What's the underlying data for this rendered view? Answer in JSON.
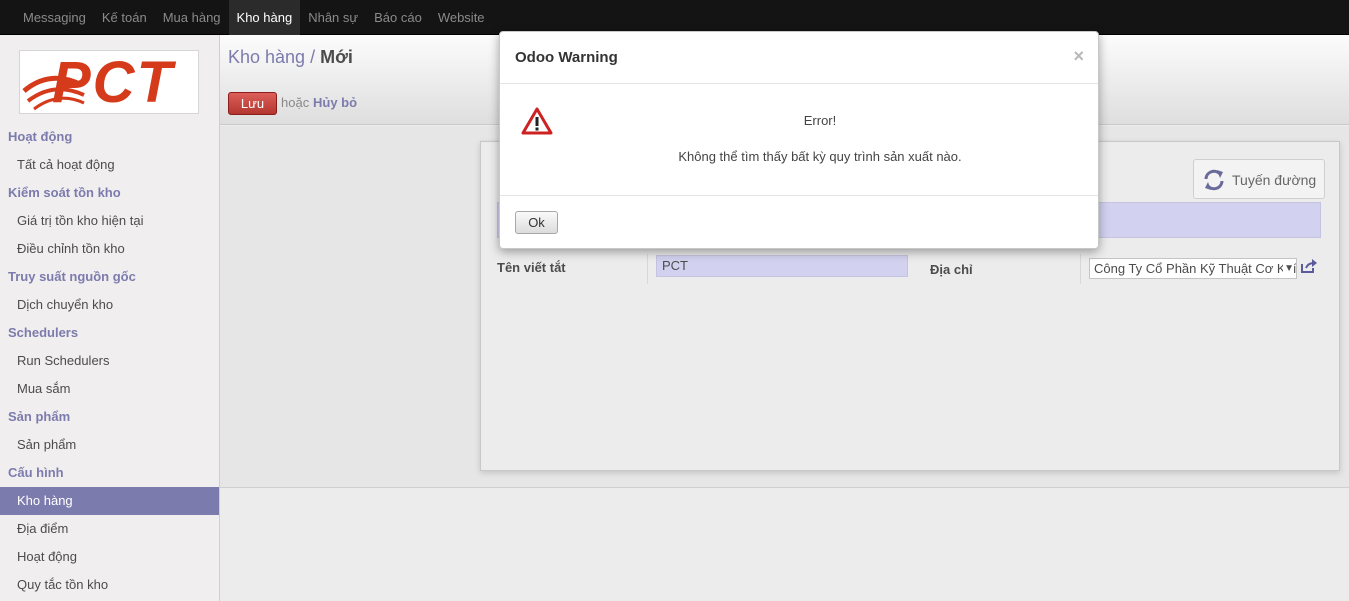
{
  "topnav": {
    "items": [
      "Messaging",
      "Kế toán",
      "Mua hàng",
      "Kho hàng",
      "Nhân sự",
      "Báo cáo",
      "Website"
    ],
    "active": "Kho hàng"
  },
  "logo": {
    "text": "PCT"
  },
  "sidebar": {
    "sections": [
      {
        "title": "Hoạt động",
        "items": [
          {
            "label": "Tất cả hoạt động"
          }
        ]
      },
      {
        "title": "Kiểm soát tồn kho",
        "items": [
          {
            "label": "Giá trị tồn kho hiện tại"
          },
          {
            "label": "Điều chỉnh tồn kho"
          }
        ]
      },
      {
        "title": "Truy suất nguồn gốc",
        "items": [
          {
            "label": "Dịch chuyển kho"
          }
        ]
      },
      {
        "title": "Schedulers",
        "items": [
          {
            "label": "Run Schedulers"
          },
          {
            "label": "Mua sắm"
          }
        ]
      },
      {
        "title": "Sản phẩm",
        "items": [
          {
            "label": "Sản phẩm"
          }
        ]
      },
      {
        "title": "Cấu hình",
        "items": [
          {
            "label": "Kho hàng",
            "active": true
          },
          {
            "label": "Địa điểm"
          },
          {
            "label": "Hoạt động"
          },
          {
            "label": "Quy tắc tồn kho"
          }
        ]
      }
    ]
  },
  "breadcrumb": {
    "parent": "Kho hàng",
    "separator": " / ",
    "current": "Mới"
  },
  "toolbar": {
    "save_label": "Lưu",
    "or_text": "hoặc",
    "discard_label": "Hủy bỏ"
  },
  "form": {
    "route_button_label": "Tuyến đường",
    "code_label": "Tên viết tắt",
    "code_value": "PCT",
    "address_label": "Địa chỉ",
    "address_value": "Công Ty Cổ Phần Kỹ Thuật Cơ Khí"
  },
  "dialog": {
    "title": "Odoo Warning",
    "close_symbol": "×",
    "error_title": "Error!",
    "error_message": "Không thể tìm thấy bất kỳ quy trình sản xuất nào.",
    "ok_label": "Ok"
  },
  "colors": {
    "accent": "#7c7bad",
    "save_button": "#c9403a",
    "brand": "#d53a1b",
    "warning": "#cc2222",
    "topbar": "#141414"
  }
}
